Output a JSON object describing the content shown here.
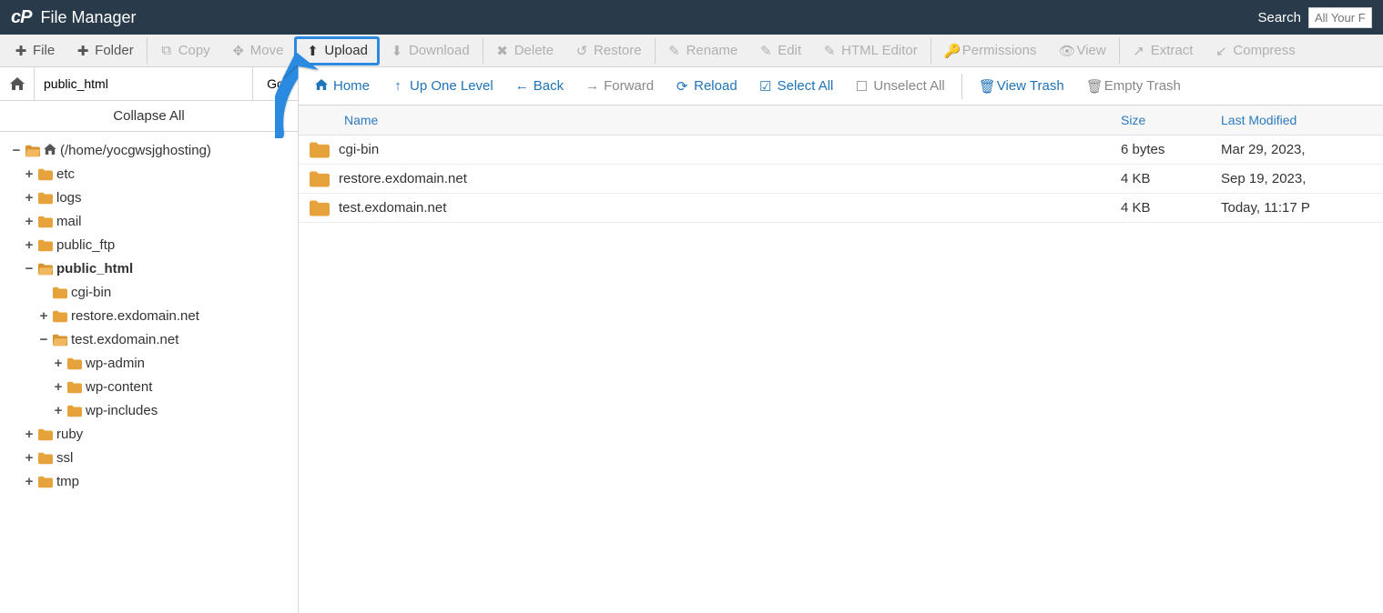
{
  "header": {
    "title": "File Manager",
    "search_label": "Search",
    "search_placeholder": "All Your Files"
  },
  "toolbar": {
    "file": "File",
    "folder": "Folder",
    "copy": "Copy",
    "move": "Move",
    "upload": "Upload",
    "download": "Download",
    "delete": "Delete",
    "restore": "Restore",
    "rename": "Rename",
    "edit": "Edit",
    "html_editor": "HTML Editor",
    "permissions": "Permissions",
    "view": "View",
    "extract": "Extract",
    "compress": "Compress"
  },
  "path": "public_html",
  "go_label": "Go",
  "collapse_all": "Collapse All",
  "tree": {
    "root": "(/home/yocgwsjghosting)",
    "etc": "etc",
    "logs": "logs",
    "mail": "mail",
    "public_ftp": "public_ftp",
    "public_html": "public_html",
    "cgi_bin": "cgi-bin",
    "restore": "restore.exdomain.net",
    "test": "test.exdomain.net",
    "wp_admin": "wp-admin",
    "wp_content": "wp-content",
    "wp_includes": "wp-includes",
    "ruby": "ruby",
    "ssl": "ssl",
    "tmp": "tmp"
  },
  "secondary": {
    "home": "Home",
    "up": "Up One Level",
    "back": "Back",
    "forward": "Forward",
    "reload": "Reload",
    "select_all": "Select All",
    "unselect_all": "Unselect All",
    "view_trash": "View Trash",
    "empty_trash": "Empty Trash"
  },
  "columns": {
    "name": "Name",
    "size": "Size",
    "modified": "Last Modified"
  },
  "rows": [
    {
      "name": "cgi-bin",
      "size": "6 bytes",
      "modified": "Mar 29, 2023,"
    },
    {
      "name": "restore.exdomain.net",
      "size": "4 KB",
      "modified": "Sep 19, 2023,"
    },
    {
      "name": "test.exdomain.net",
      "size": "4 KB",
      "modified": "Today, 11:17 P"
    }
  ]
}
